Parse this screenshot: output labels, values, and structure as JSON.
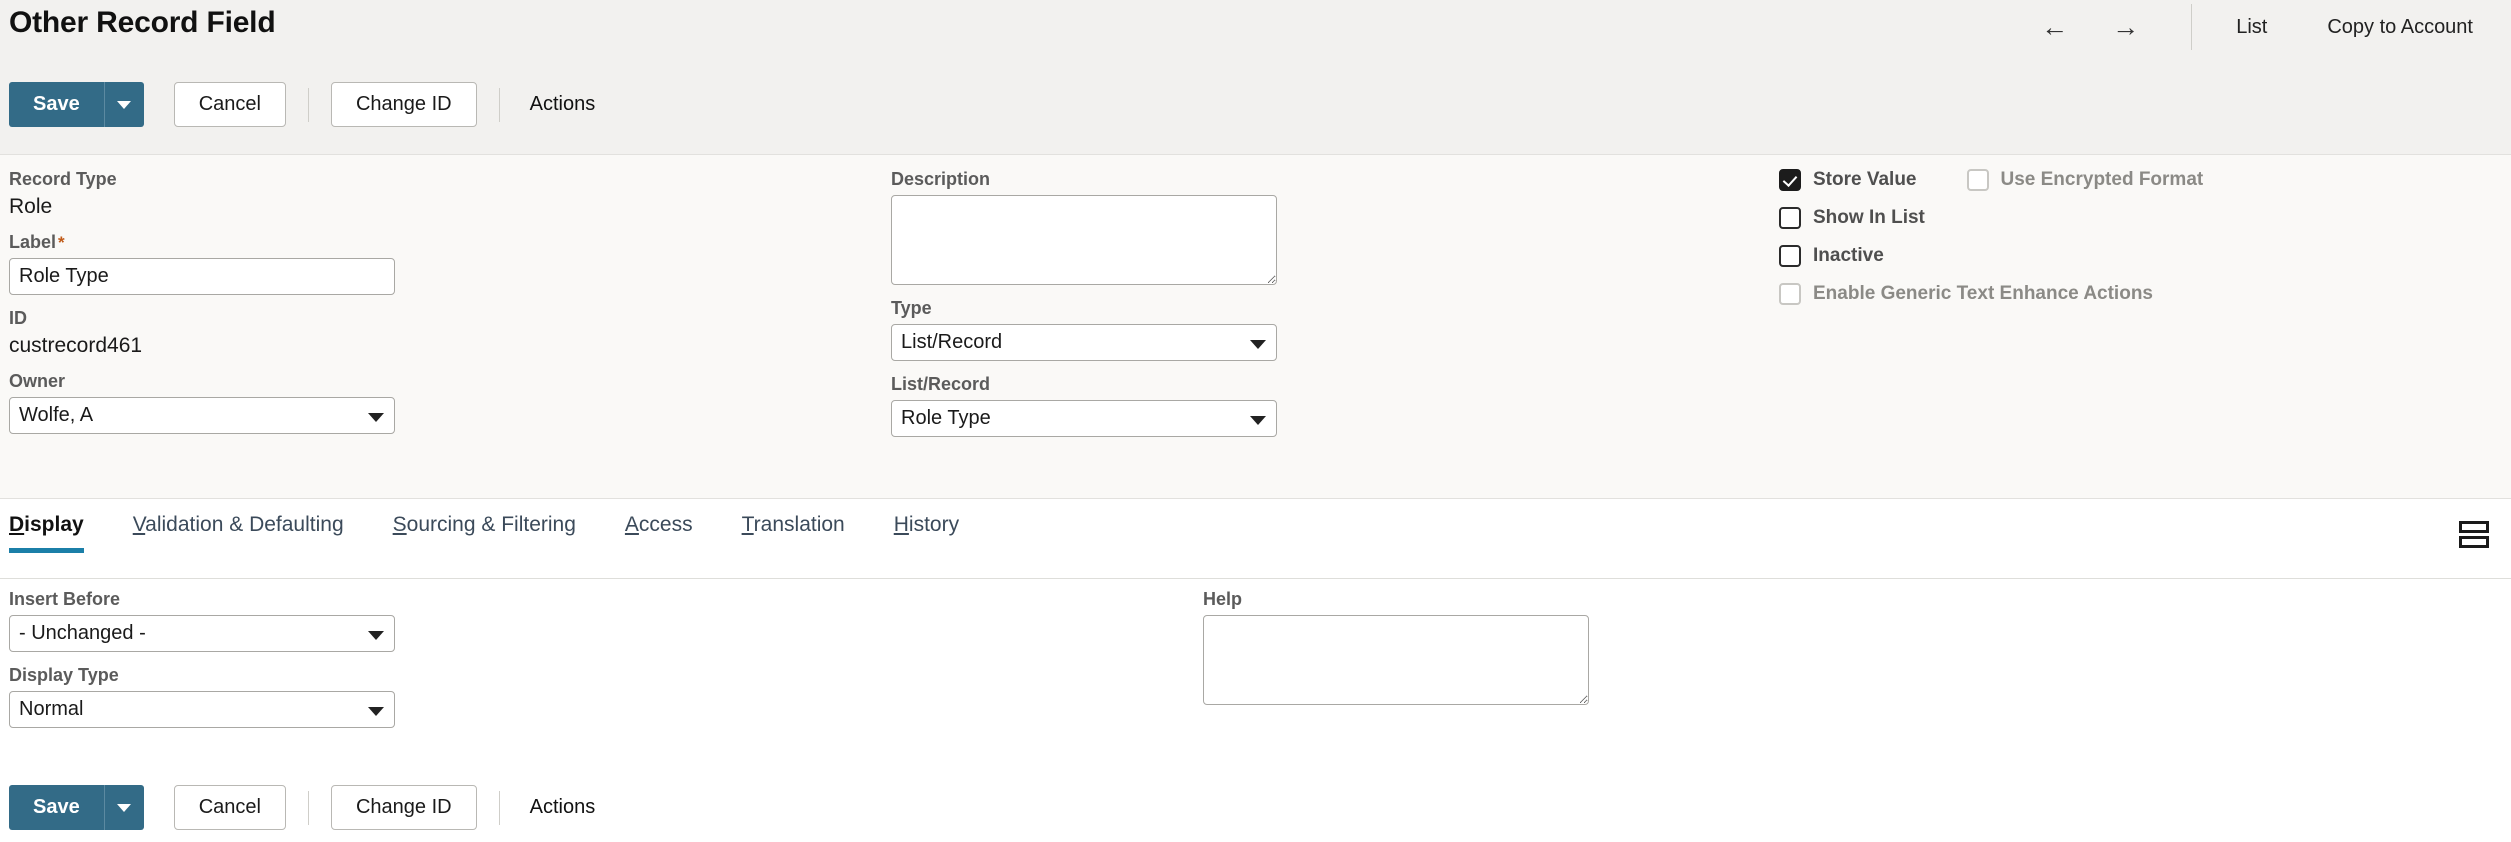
{
  "header": {
    "title": "Other Record Field",
    "back_arrow": "←",
    "forward_arrow": "→",
    "list_link": "List",
    "copy_link": "Copy to Account"
  },
  "toolbar": {
    "save_label": "Save",
    "save_caret_label": "▼",
    "cancel_label": "Cancel",
    "change_id_label": "Change ID",
    "actions_label": "Actions"
  },
  "form": {
    "record_type_label": "Record Type",
    "record_type_value": "Role",
    "label_label": "Label",
    "label_required_marker": "*",
    "label_value": "Role Type",
    "id_label": "ID",
    "id_value": "custrecord461",
    "owner_label": "Owner",
    "owner_value": "Wolfe, A",
    "description_label": "Description",
    "description_value": "",
    "type_label": "Type",
    "type_value": "List/Record",
    "list_record_label": "List/Record",
    "list_record_value": "Role Type"
  },
  "checkboxes": [
    {
      "label": "Store Value",
      "checked": true,
      "disabled": false
    },
    {
      "label": "Use Encrypted Format",
      "checked": false,
      "disabled": true
    },
    {
      "label": "Show In List",
      "checked": false,
      "disabled": false
    },
    {
      "label": "Inactive",
      "checked": false,
      "disabled": false
    },
    {
      "label": "Enable Generic Text Enhance Actions",
      "checked": false,
      "disabled": true
    }
  ],
  "tabs": [
    {
      "accesskey": "D",
      "rest": "isplay",
      "active": true
    },
    {
      "accesskey": "V",
      "rest": "alidation & Defaulting",
      "active": false
    },
    {
      "accesskey": "S",
      "rest": "ourcing & Filtering",
      "active": false
    },
    {
      "accesskey": "A",
      "rest": "ccess",
      "active": false
    },
    {
      "accesskey": "T",
      "rest": "ranslation",
      "active": false
    },
    {
      "accesskey": "H",
      "rest": "istory",
      "active": false
    }
  ],
  "display_tab": {
    "insert_before_label": "Insert Before",
    "insert_before_value": "- Unchanged -",
    "display_type_label": "Display Type",
    "display_type_value": "Normal",
    "help_label": "Help",
    "help_value": ""
  },
  "colors": {
    "primary_button": "#336b87",
    "active_tab_underline": "#1b7fa8",
    "header_band": "#f2f1ef",
    "form_background": "#faf9f7",
    "required_star": "#c05a18"
  }
}
